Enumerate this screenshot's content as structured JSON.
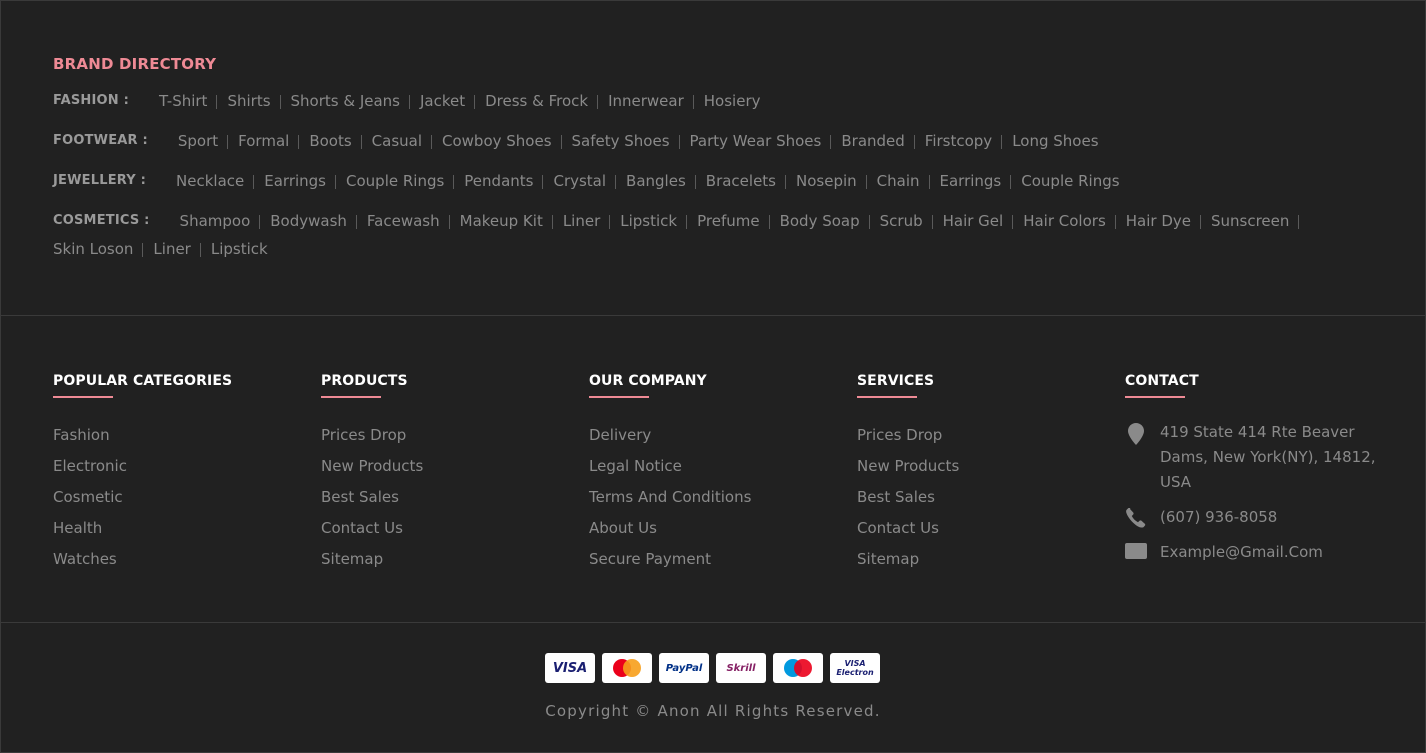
{
  "brand_directory": {
    "title": "BRAND DIRECTORY",
    "rows": [
      {
        "label": "FASHION :",
        "links": [
          "T-Shirt",
          "Shirts",
          "Shorts & Jeans",
          "Jacket",
          "Dress & Frock",
          "Innerwear",
          "Hosiery"
        ]
      },
      {
        "label": "FOOTWEAR :",
        "links": [
          "Sport",
          "Formal",
          "Boots",
          "Casual",
          "Cowboy Shoes",
          "Safety Shoes",
          "Party Wear Shoes",
          "Branded",
          "Firstcopy",
          "Long Shoes"
        ]
      },
      {
        "label": "JEWELLERY :",
        "links": [
          "Necklace",
          "Earrings",
          "Couple Rings",
          "Pendants",
          "Crystal",
          "Bangles",
          "Bracelets",
          "Nosepin",
          "Chain",
          "Earrings",
          "Couple Rings"
        ]
      },
      {
        "label": "COSMETICS :",
        "links": [
          "Shampoo",
          "Bodywash",
          "Facewash",
          "Makeup Kit",
          "Liner",
          "Lipstick",
          "Prefume",
          "Body Soap",
          "Scrub",
          "Hair Gel",
          "Hair Colors",
          "Hair Dye",
          "Sunscreen",
          "Skin Loson",
          "Liner",
          "Lipstick"
        ]
      }
    ]
  },
  "columns": [
    {
      "title": "POPULAR CATEGORIES",
      "items": [
        "Fashion",
        "Electronic",
        "Cosmetic",
        "Health",
        "Watches"
      ]
    },
    {
      "title": "PRODUCTS",
      "items": [
        "Prices Drop",
        "New Products",
        "Best Sales",
        "Contact Us",
        "Sitemap"
      ]
    },
    {
      "title": "OUR COMPANY",
      "items": [
        "Delivery",
        "Legal Notice",
        "Terms And Conditions",
        "About Us",
        "Secure Payment"
      ]
    },
    {
      "title": "SERVICES",
      "items": [
        "Prices Drop",
        "New Products",
        "Best Sales",
        "Contact Us",
        "Sitemap"
      ]
    }
  ],
  "contact": {
    "title": "CONTACT",
    "address": "419 State 414 Rte Beaver Dams, New York(NY), 14812, USA",
    "phone": "(607) 936-8058",
    "email": "Example@Gmail.Com",
    "icons": [
      "location-pin-icon",
      "phone-icon",
      "mail-icon"
    ]
  },
  "payments": [
    {
      "name": "VISA",
      "icon": "visa-logo",
      "color": "#1a1f71"
    },
    {
      "name": "MasterCard",
      "icon": "mastercard-logo",
      "color": "#eb001b"
    },
    {
      "name": "PayPal",
      "icon": "paypal-logo",
      "color": "#003087"
    },
    {
      "name": "Skrill",
      "icon": "skrill-logo",
      "color": "#862165"
    },
    {
      "name": "Maestro",
      "icon": "maestro-logo",
      "color": "#0099df"
    },
    {
      "name": "VISA Electron",
      "icon": "visa-electron-logo",
      "color": "#1a1f71"
    }
  ],
  "copyright": "Copyright © Anon All Rights Reserved.",
  "colors": {
    "background": "#212121",
    "accent": "#ee8a95",
    "text": "#8a8a8a",
    "heading": "#ffffff"
  }
}
